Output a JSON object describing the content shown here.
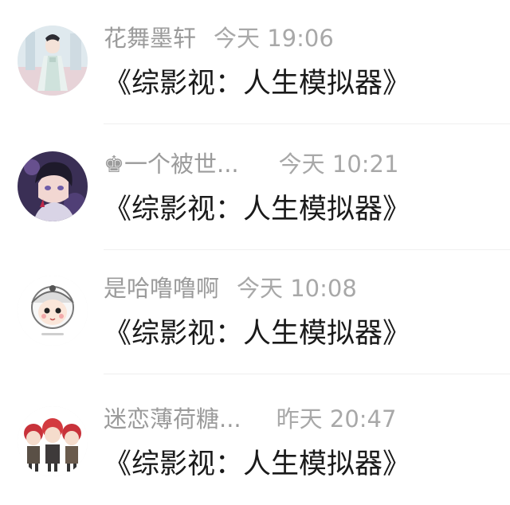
{
  "comments": [
    {
      "username": "花舞墨轩",
      "time": "今天 19:06",
      "message": "《综影视：人生模拟器》",
      "avatar_icon": "avatar-ancient-costume-icon"
    },
    {
      "username": "♚一个被世...",
      "time": "今天 10:21",
      "message": "《综影视：人生模拟器》",
      "avatar_icon": "avatar-anime-boy-icon"
    },
    {
      "username": "是哈噜噜啊",
      "time": "今天 10:08",
      "message": "《综影视：人生模拟器》",
      "avatar_icon": "avatar-cartoon-helmet-icon"
    },
    {
      "username": "迷恋薄荷糖...",
      "time": "昨天 20:47",
      "message": "《综影视：人生模拟器》",
      "avatar_icon": "avatar-chibi-group-icon"
    }
  ]
}
